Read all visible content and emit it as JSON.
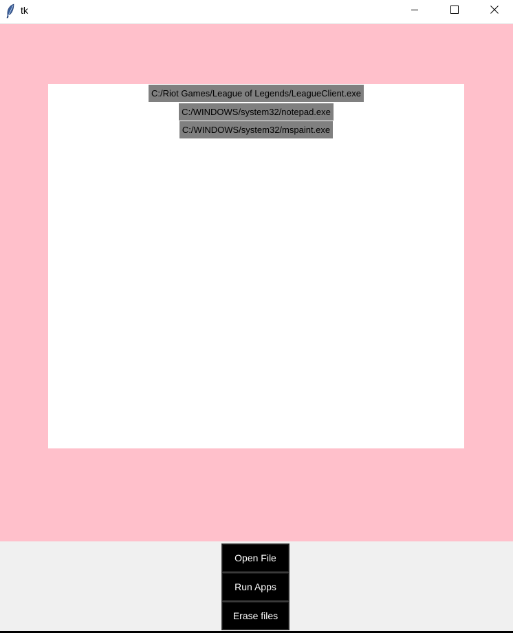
{
  "window": {
    "title": "tk",
    "colors": {
      "canvas_bg": "#ffc0cb",
      "listbox_bg": "#ffffff",
      "selected_bg": "#808080",
      "button_bg": "#000000",
      "button_fg": "#ffffff"
    },
    "icons": {
      "app": "feather-icon",
      "minimize": "minimize-icon",
      "maximize": "maximize-icon",
      "close": "close-icon"
    }
  },
  "files": [
    "C:/Riot Games/League of Legends/LeagueClient.exe",
    "C:/WINDOWS/system32/notepad.exe",
    "C:/WINDOWS/system32/mspaint.exe"
  ],
  "buttons": {
    "open_file": "Open File",
    "run_apps": "Run Apps",
    "erase_files": "Erase files"
  }
}
